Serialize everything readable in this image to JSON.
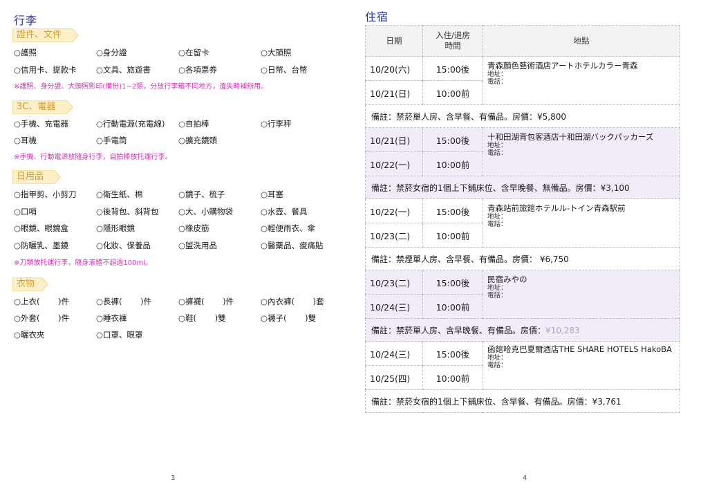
{
  "left_page": {
    "title": "行李",
    "page_number": "3",
    "sections": [
      {
        "label": "證件、文件",
        "items": [
          "○護照",
          "○身分證",
          "○在留卡",
          "○大頭照",
          "○信用卡、提款卡",
          "○文具、旅遊書",
          "○各項票券",
          "○日幣、台幣"
        ],
        "note": "※護照、身分證、大頭照影印(備份)1~2張，分放行李箱不同地方，遺失時補辦用。"
      },
      {
        "label": "3C、電器",
        "items": [
          "○手機、充電器",
          "○行動電源(充電線)",
          "○自拍棒",
          "○行李秤",
          "○耳機",
          "○手電筒",
          "○擴充鏡頭"
        ],
        "note": "※手機、行動電源放隨身行李，自拍棒放托運行李。"
      },
      {
        "label": "日用品",
        "items": [
          "○指甲剪、小剪刀",
          "○衛生紙、棉",
          "○鏡子、梳子",
          "○耳塞",
          "○口哨",
          "○後背包、斜背包",
          "○大、小購物袋",
          "○水壺、餐具",
          "○眼鏡、眼鏡盒",
          "○隱形眼鏡",
          "○橡皮筋",
          "○輕便雨衣、傘",
          "○防曬乳、墨鏡",
          "○化妝、保養品",
          "○盥洗用品",
          "○醫藥品、痠痛貼"
        ],
        "note": "※刀類放托運行李，隨身液體不超過100ml。"
      },
      {
        "label": "衣物",
        "items": [
          "○上衣(　　 )件",
          "○長褲(　　 )件",
          "○褲襪(　　 )件",
          "○內衣褲(　　 )套",
          "○外套(　　 )件",
          "○睡衣褲",
          "○鞋(　　 )雙",
          "○襪子(　　 )雙",
          "○曬衣夾",
          "○口罩、眼罩"
        ],
        "note": ""
      }
    ]
  },
  "right_page": {
    "title": "住宿",
    "page_number": "4",
    "headers": {
      "date": "日期",
      "checkin_line1": "入住/退房",
      "checkin_line2": "時間",
      "place": "地點"
    },
    "addr_label": "地址：",
    "tel_label": "電話：",
    "stays": [
      {
        "in_date": "10/20(六)",
        "in_time": "15:00後",
        "out_date": "10/21(日)",
        "out_time": "10:00前",
        "name": "青森顏色藝術酒店アートホテルカラー青森",
        "remark": "備註：禁菸單人房、含早餐、有備品。房價：¥5,800",
        "remark_price": ""
      },
      {
        "in_date": "10/21(日)",
        "in_time": "15:00後",
        "out_date": "10/22(一)",
        "out_time": "10:00前",
        "name": "十和田湖背包客酒店十和田湖バックパッカーズ",
        "remark": "備註：禁菸女宿的1個上下鋪床位、含早晚餐、無備品。房價：¥3,100",
        "remark_price": ""
      },
      {
        "in_date": "10/22(一)",
        "in_time": "15:00後",
        "out_date": "10/23(二)",
        "out_time": "10:00前",
        "name": "青森站前旅館ホテルル-トイン青森駅前",
        "remark": "備註：禁煙單人房、含早餐、有備品。房價： ¥6,750",
        "remark_price": ""
      },
      {
        "in_date": "10/23(二)",
        "in_time": "15:00後",
        "out_date": "10/24(三)",
        "out_time": "10:00前",
        "name": "民宿みやの",
        "remark": "備註：禁菸單人房、含早晚餐、有備品。房價：",
        "remark_price": "¥10,283"
      },
      {
        "in_date": "10/24(三)",
        "in_time": "15:00後",
        "out_date": "10/25(四)",
        "out_time": "10:00前",
        "name": "函館哈克巴夏爾酒店THE SHARE HOTELS HakoBA",
        "remark": "備註：禁菸女宿的1個上下鋪床位、含早餐、有備品。房價：¥3,761",
        "remark_price": ""
      }
    ]
  },
  "colors": {
    "title": "#1f2fa0",
    "tag_fill": "#fdf0c8",
    "tag_text": "#d99a2b",
    "note": "#d633b4",
    "shade": "#f1ecf8",
    "gray_price": "#a5a5c5"
  }
}
